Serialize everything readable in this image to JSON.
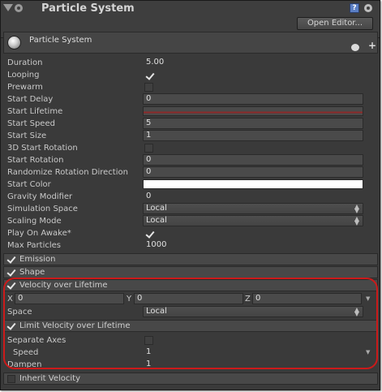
{
  "window": {
    "title": "Particle System",
    "open_editor_label": "Open Editor..."
  },
  "component": {
    "name": "Particle System"
  },
  "properties": [
    {
      "label": "Duration",
      "value": "5.00"
    },
    {
      "label": "Looping",
      "value": "checked"
    },
    {
      "label": "Prewarm",
      "value": "unchecked"
    },
    {
      "label": "Start Delay",
      "value": "0"
    },
    {
      "label": "Start Lifetime",
      "value": ""
    },
    {
      "label": "Start Speed",
      "value": "5"
    },
    {
      "label": "Start Size",
      "value": "1"
    },
    {
      "label": "3D Start Rotation",
      "value": "unchecked"
    },
    {
      "label": "Start Rotation",
      "value": "0"
    },
    {
      "label": "Randomize Rotation Direction",
      "value": "0"
    },
    {
      "label": "Start Color",
      "value": ""
    },
    {
      "label": "Gravity Modifier",
      "value": "0"
    },
    {
      "label": "Simulation Space",
      "value": "Local"
    },
    {
      "label": "Scaling Mode",
      "value": "Local"
    },
    {
      "label": "Play On Awake*",
      "value": "checked"
    },
    {
      "label": "Max Particles",
      "value": "1000"
    }
  ],
  "sections": {
    "emission": "Emission",
    "shape": "Shape",
    "velocity": "Velocity over Lifetime",
    "limit_velocity": "Limit Velocity over Lifetime",
    "inherit_velocity": "Inherit Velocity"
  },
  "velocity": {
    "x_label": "X",
    "x_value": "0",
    "y_label": "Y",
    "y_value": "0",
    "z_label": "Z",
    "z_value": "0",
    "space_label": "Space",
    "space_value": "Local"
  },
  "limit_velocity": {
    "separate_axes_label": "Separate Axes",
    "speed_label": "Speed",
    "speed_value": "1",
    "dampen_label": "Dampen",
    "dampen_value": "1"
  },
  "colors": {
    "start_lifetime_bar": "#8c2a2a",
    "start_color_swatch": "#ffffff",
    "highlight": "#cc1a1a"
  },
  "icons": {
    "collapse": "triangle-down-icon",
    "component_settings": "gear-icon",
    "help": "help-icon",
    "particle": "sphere-icon",
    "lightbulb": "lightbulb-icon",
    "add": "plus-icon"
  }
}
